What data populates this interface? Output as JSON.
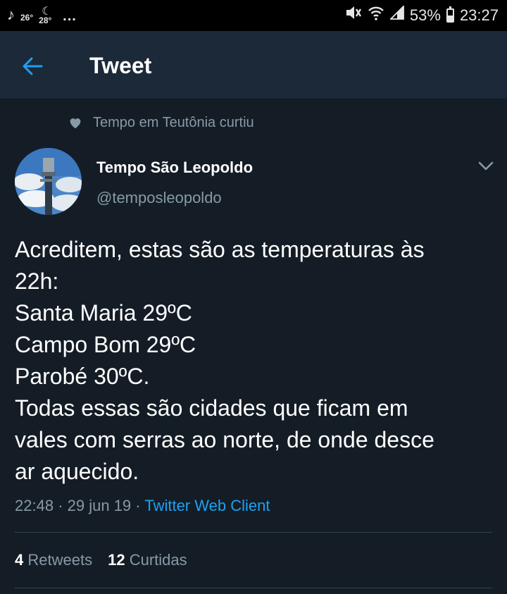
{
  "status_bar": {
    "music_icon": "music-note-icon",
    "temp_now": "26°",
    "temp_night": "28°",
    "more": "...",
    "icons": [
      "mute-icon",
      "wifi-icon",
      "signal-icon",
      "battery-icon"
    ],
    "battery_percent": "53%",
    "battery_level": 0.53,
    "time": "23:27"
  },
  "app_bar": {
    "title": "Tweet",
    "back_icon": "back-arrow-icon"
  },
  "social_context": {
    "icon": "heart-icon",
    "text": "Tempo em Teutônia curtiu"
  },
  "tweet": {
    "author_name": "Tempo São Leopoldo",
    "author_handle": "@temposleopoldo",
    "lines": [
      "Acreditem, estas são as temperaturas às",
      "22h:",
      "Santa Maria 29ºC",
      "Campo Bom 29ºC",
      "Parobé 30ºC.",
      "Todas essas são cidades que ficam em",
      "vales com serras ao norte, de onde desce",
      "ar aquecido."
    ],
    "time": "22:48",
    "date": "29 jun 19",
    "separator": "·",
    "client": "Twitter Web Client"
  },
  "stats": {
    "retweets_count": "4",
    "retweets_label": "Retweets",
    "likes_count": "12",
    "likes_label": "Curtidas"
  },
  "colors": {
    "background": "#141d26",
    "app_bar": "#1c2938",
    "accent": "#1da1f2",
    "secondary_text": "#8899a6",
    "divider": "#38444d"
  }
}
